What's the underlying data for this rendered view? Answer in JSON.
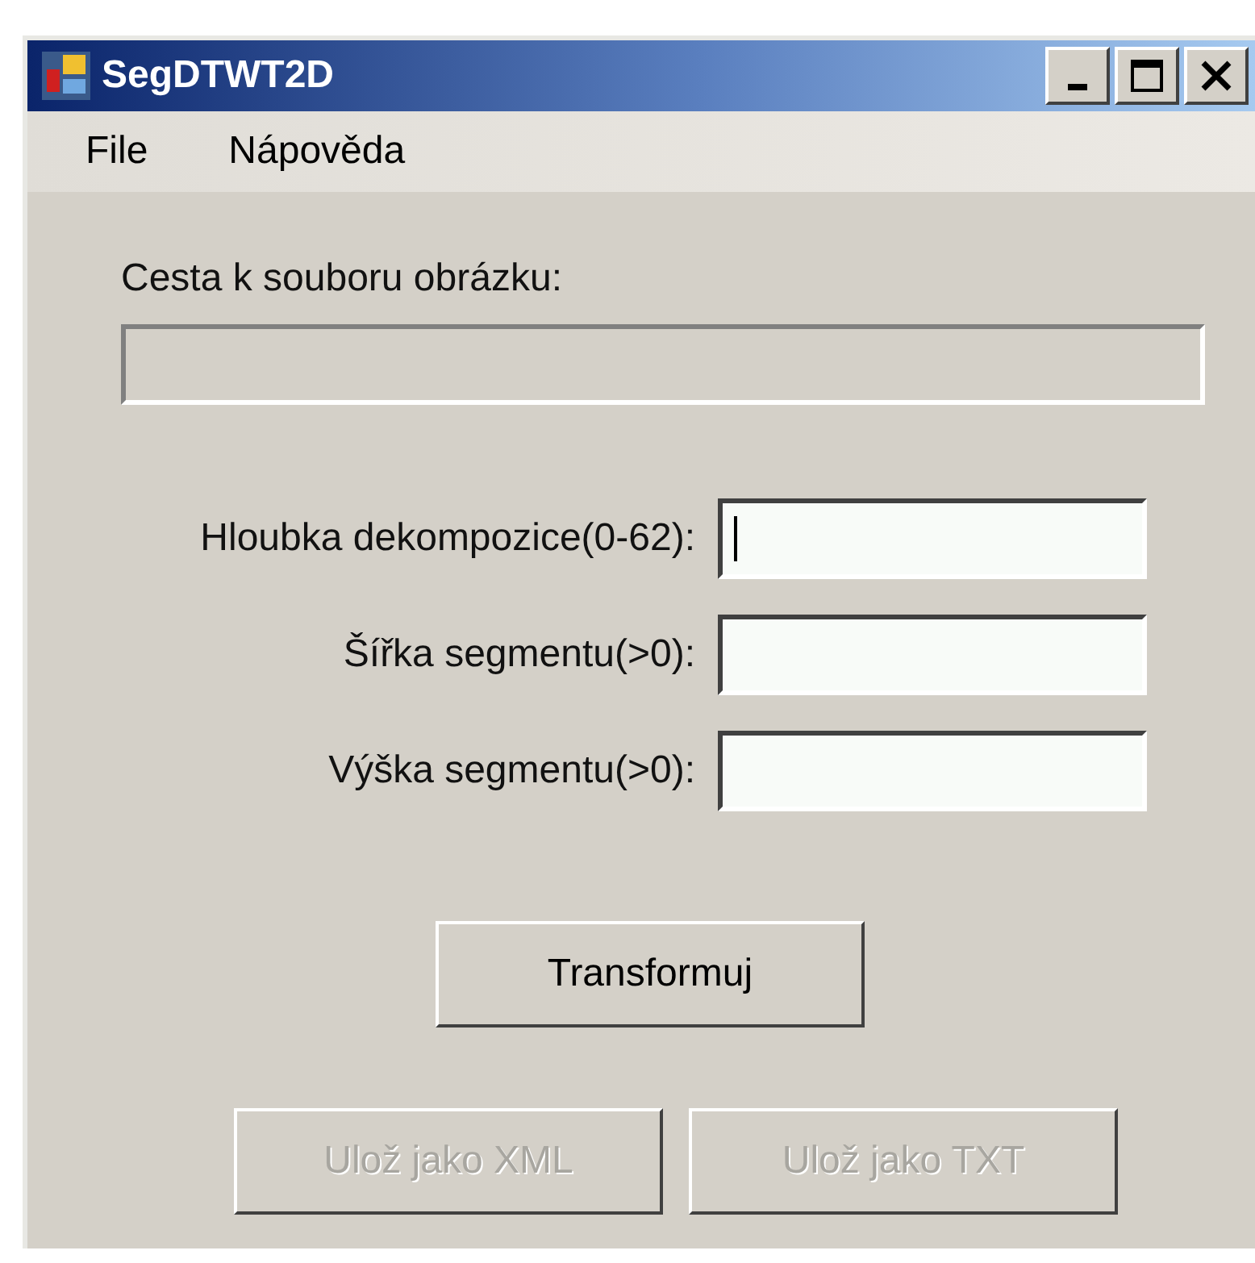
{
  "window": {
    "title": "SegDTWT2D"
  },
  "menu": [
    "File",
    "Nápověda"
  ],
  "path_field": {
    "label": "Cesta k souboru obrázku:",
    "disabled": true
  },
  "fields": [
    {
      "label": "Hloubka dekompozice(0-62):",
      "focused": true
    },
    {
      "label": "Šířka segmentu(>0):",
      "focused": false
    },
    {
      "label": "Výška segmentu(>0):",
      "focused": false
    }
  ],
  "buttons": [
    {
      "label": "Transformuj",
      "disabled": false
    }
  ],
  "save_buttons": [
    {
      "label": "Ulož jako XML",
      "disabled": true
    },
    {
      "label": "Ulož jako TXT",
      "disabled": true
    }
  ]
}
